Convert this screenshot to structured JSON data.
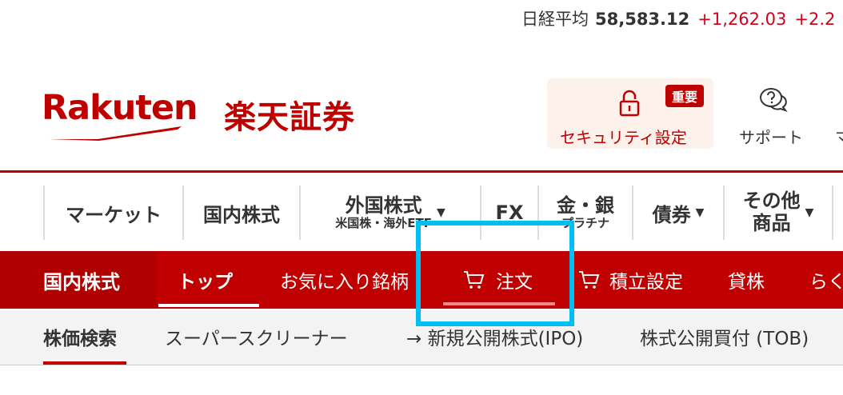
{
  "ticker": {
    "name": "日経平均",
    "value": "58,583.12",
    "change": "+1,262.03",
    "pct": "+2.2"
  },
  "brand": {
    "logo_text": "Rakuten",
    "jp_name": "楽天証券"
  },
  "header": {
    "security": {
      "label": "セキュリティ設定",
      "badge": "重要"
    },
    "support": {
      "label": "サポート"
    },
    "more": "マ"
  },
  "nav": {
    "market": "マーケット",
    "domestic": "国内株式",
    "foreign": "外国株式",
    "foreign_sub": "米国株・海外ETF",
    "fx": "FX",
    "gold": "金・銀",
    "gold_sub": "プラチナ",
    "bonds": "債券",
    "other_1": "その他",
    "other_2": "商品"
  },
  "subnav": {
    "section": "国内株式",
    "tabs": [
      "トップ",
      "お気に入り銘柄",
      "注文",
      "積立設定",
      "貸株",
      "らく"
    ]
  },
  "greybar": {
    "tabs": [
      "株価検索",
      "スーパースクリーナー",
      "→ 新規公開株式(IPO)",
      "株式公開買付 (TOB)"
    ]
  },
  "colors": {
    "brand_red": "#bf0000",
    "highlight": "#00bff0",
    "positive": "#d0021b"
  }
}
